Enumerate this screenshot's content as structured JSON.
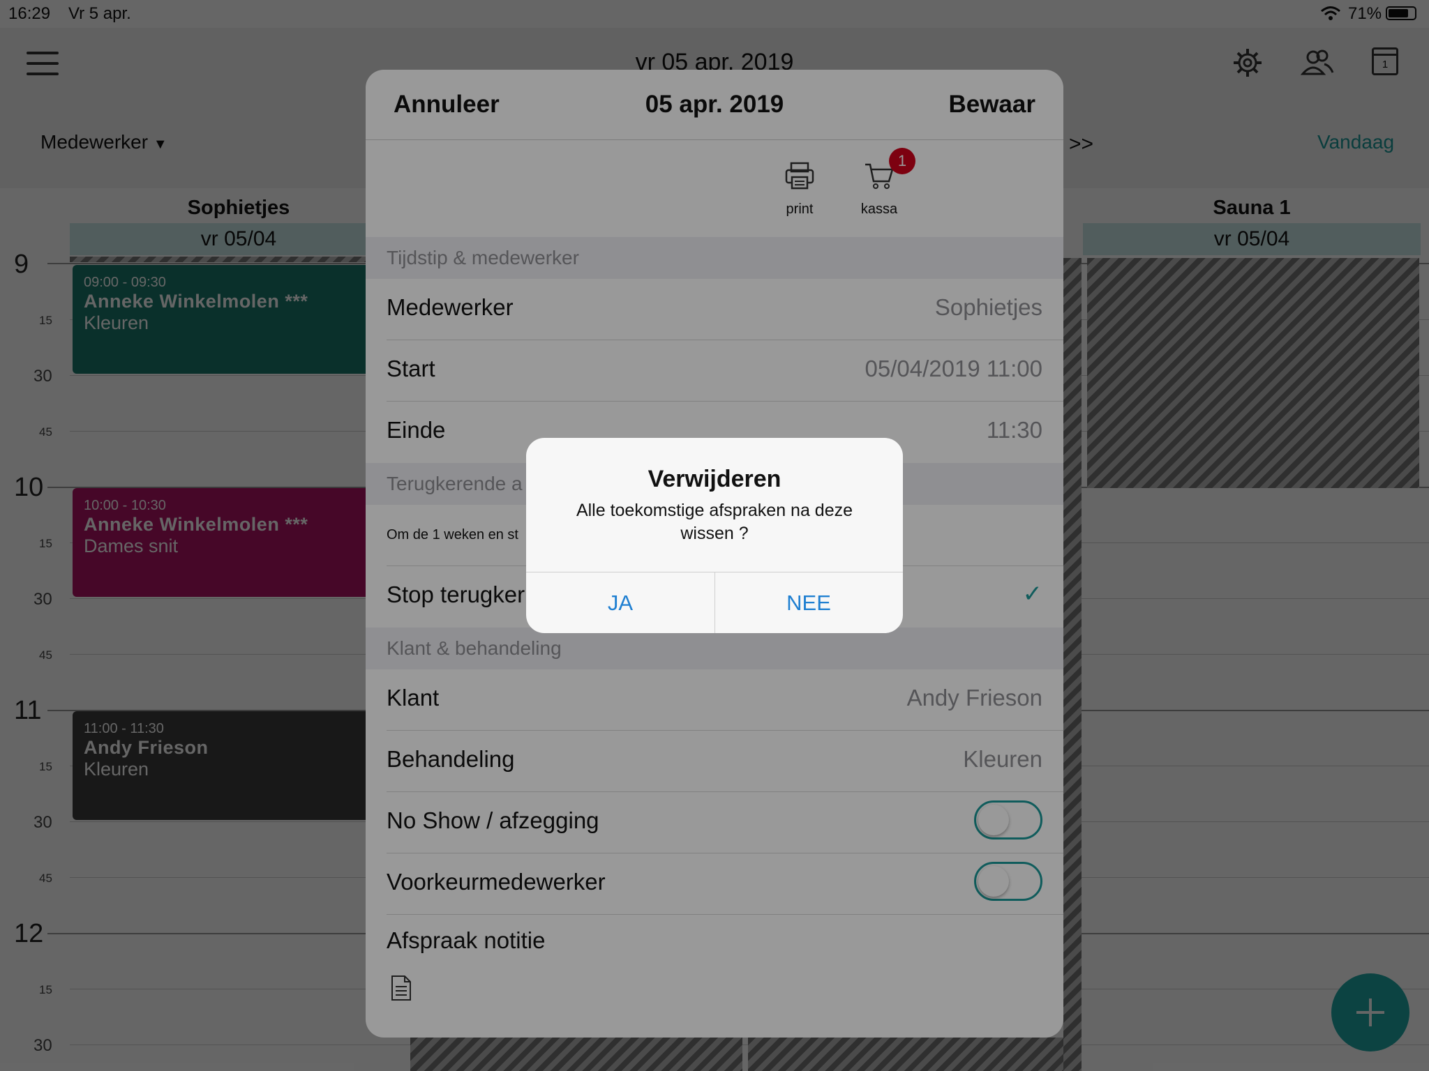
{
  "status_bar": {
    "time": "16:29",
    "date": "Vr 5 apr.",
    "battery": "71%",
    "icons": [
      "wifi-icon",
      "battery-icon"
    ]
  },
  "header": {
    "title": "vr 05 apr. 2019",
    "employee_filter": "Medewerker",
    "next_label": ">>",
    "today_label": "Vandaag",
    "icons": [
      "menu-icon",
      "gear-icon",
      "users-icon",
      "calendar-icon"
    ],
    "calendar_day": "1"
  },
  "columns": [
    {
      "name": "Sophietjes",
      "date": "vr 05/04"
    },
    {
      "name": "Sauna  1",
      "date": "vr 05/04"
    }
  ],
  "time_axis": {
    "hours": [
      "9",
      "10",
      "11",
      "12"
    ],
    "quarter_labels": [
      "15",
      "30",
      "45"
    ],
    "last_label": "30"
  },
  "appointments": [
    {
      "time": "09:00 - 09:30",
      "name": "Anneke Winkelmolen ***",
      "service": "Kleuren",
      "color": "#1a7a6c"
    },
    {
      "time": "10:00 - 10:30",
      "name": "Anneke Winkelmolen ***",
      "service": "Dames snit",
      "color": "#b01465"
    },
    {
      "time": "11:00 - 11:30",
      "name": "Andy Frieson",
      "service": "Kleuren",
      "color": "#3c3c3c"
    }
  ],
  "sheet": {
    "cancel": "Annuleer",
    "title": "05 apr. 2019",
    "save": "Bewaar",
    "actions": {
      "print": "print",
      "kassa": "kassa",
      "kassa_badge": "1"
    },
    "group_time": "Tijdstip & medewerker",
    "employee_label": "Medewerker",
    "employee_value": "Sophietjes",
    "start_label": "Start",
    "start_value": "05/04/2019 11:00",
    "end_label": "Einde",
    "end_value": "11:30",
    "group_recurring": "Terugkerende a",
    "recurring_text": "Om de 1 weken en st",
    "stop_recurring_label": "Stop terugker",
    "group_client": "Klant & behandeling",
    "client_label": "Klant",
    "client_value": "Andy Frieson",
    "treatment_label": "Behandeling",
    "treatment_value": "Kleuren",
    "noshow_label": "No Show / afzegging",
    "noshow_on": false,
    "preferred_label": "Voorkeurmedewerker",
    "preferred_on": false,
    "note_label": "Afspraak notitie"
  },
  "alert": {
    "title": "Verwijderen",
    "message": "Alle toekomstige afspraken na deze wissen ?",
    "yes": "JA",
    "no": "NEE"
  },
  "colors": {
    "accent": "#1b9a99",
    "link": "#1f7fd1",
    "badge": "#d0021b"
  }
}
